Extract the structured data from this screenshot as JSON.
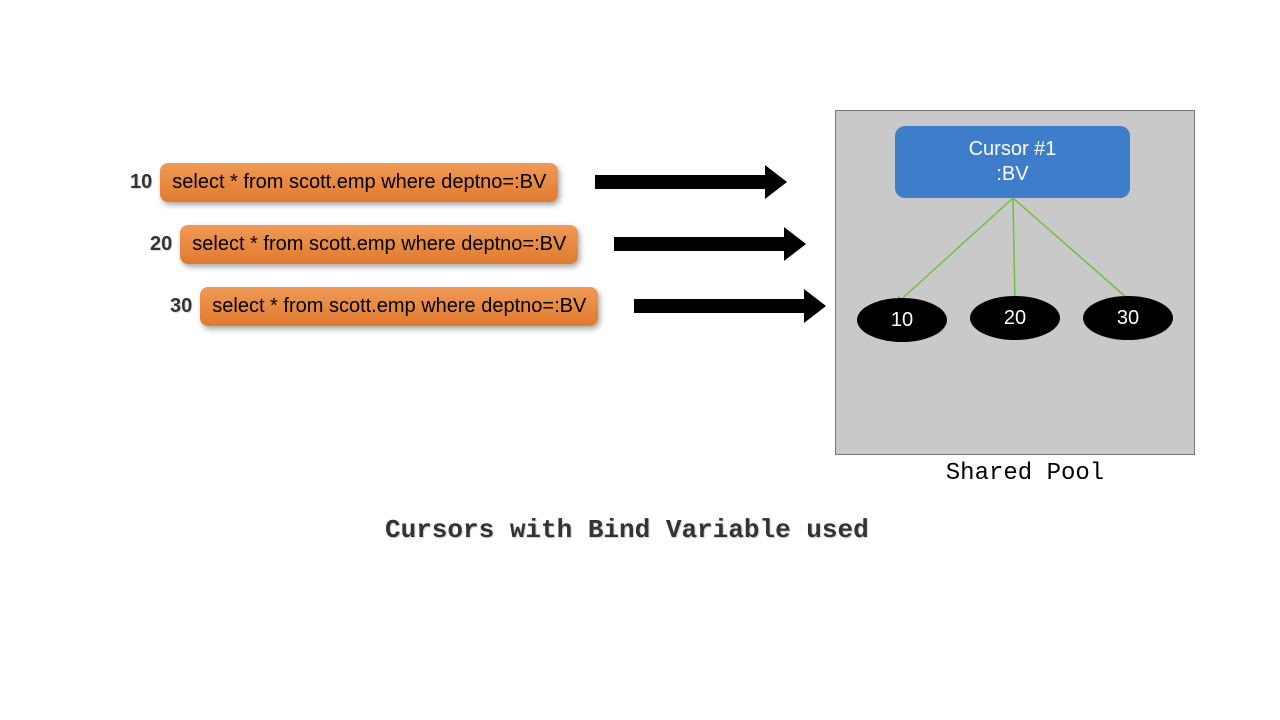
{
  "queries": [
    {
      "num": "10",
      "sql": "select * from scott.emp where deptno=:BV"
    },
    {
      "num": "20",
      "sql": "select * from scott.emp where deptno=:BV"
    },
    {
      "num": "30",
      "sql": "select * from scott.emp where deptno=:BV"
    }
  ],
  "cursor": {
    "title": "Cursor #1",
    "bind": ":BV"
  },
  "bind_values": [
    "10",
    "20",
    "30"
  ],
  "pool_label": "Shared Pool",
  "caption": "Cursors with Bind Variable used",
  "colors": {
    "query_box": "#e8863d",
    "cursor_box": "#3d7dca",
    "pool_bg": "#c9c9c9",
    "arrow_green": "#6fbf3f"
  }
}
